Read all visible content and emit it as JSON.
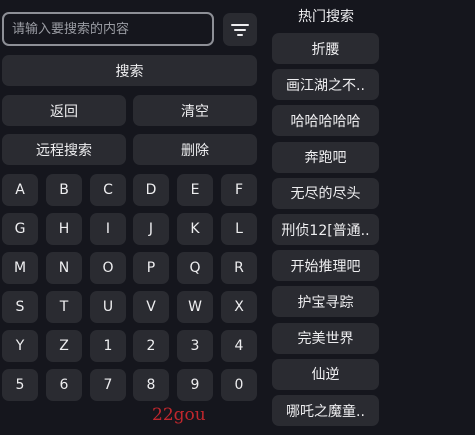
{
  "search": {
    "placeholder": "请输入要搜索的内容",
    "value": ""
  },
  "filter": {
    "icon": "filter-icon"
  },
  "actions": {
    "search_label": "搜索",
    "back_label": "返回",
    "clear_label": "清空",
    "remote_search_label": "远程搜索",
    "delete_label": "删除"
  },
  "keyboard": {
    "rows": [
      [
        "A",
        "B",
        "C",
        "D",
        "E",
        "F"
      ],
      [
        "G",
        "H",
        "I",
        "J",
        "K",
        "L"
      ],
      [
        "M",
        "N",
        "O",
        "P",
        "Q",
        "R"
      ],
      [
        "S",
        "T",
        "U",
        "V",
        "W",
        "X"
      ],
      [
        "Y",
        "Z",
        "1",
        "2",
        "3",
        "4"
      ],
      [
        "5",
        "6",
        "7",
        "8",
        "9",
        "0"
      ]
    ]
  },
  "hot": {
    "title": "热门搜索",
    "items": [
      "折腰",
      "画江湖之不..",
      "哈哈哈哈哈",
      "奔跑吧",
      "无尽的尽头",
      "刑侦12[普通..",
      "开始推理吧",
      "护宝寻踪",
      "完美世界",
      "仙逆",
      "哪吒之魔童.."
    ]
  },
  "watermark": "22gou",
  "colors": {
    "background": "#15161d",
    "button": "#2a2b31",
    "input_border": "#8d8f96",
    "watermark": "#c0272d"
  }
}
